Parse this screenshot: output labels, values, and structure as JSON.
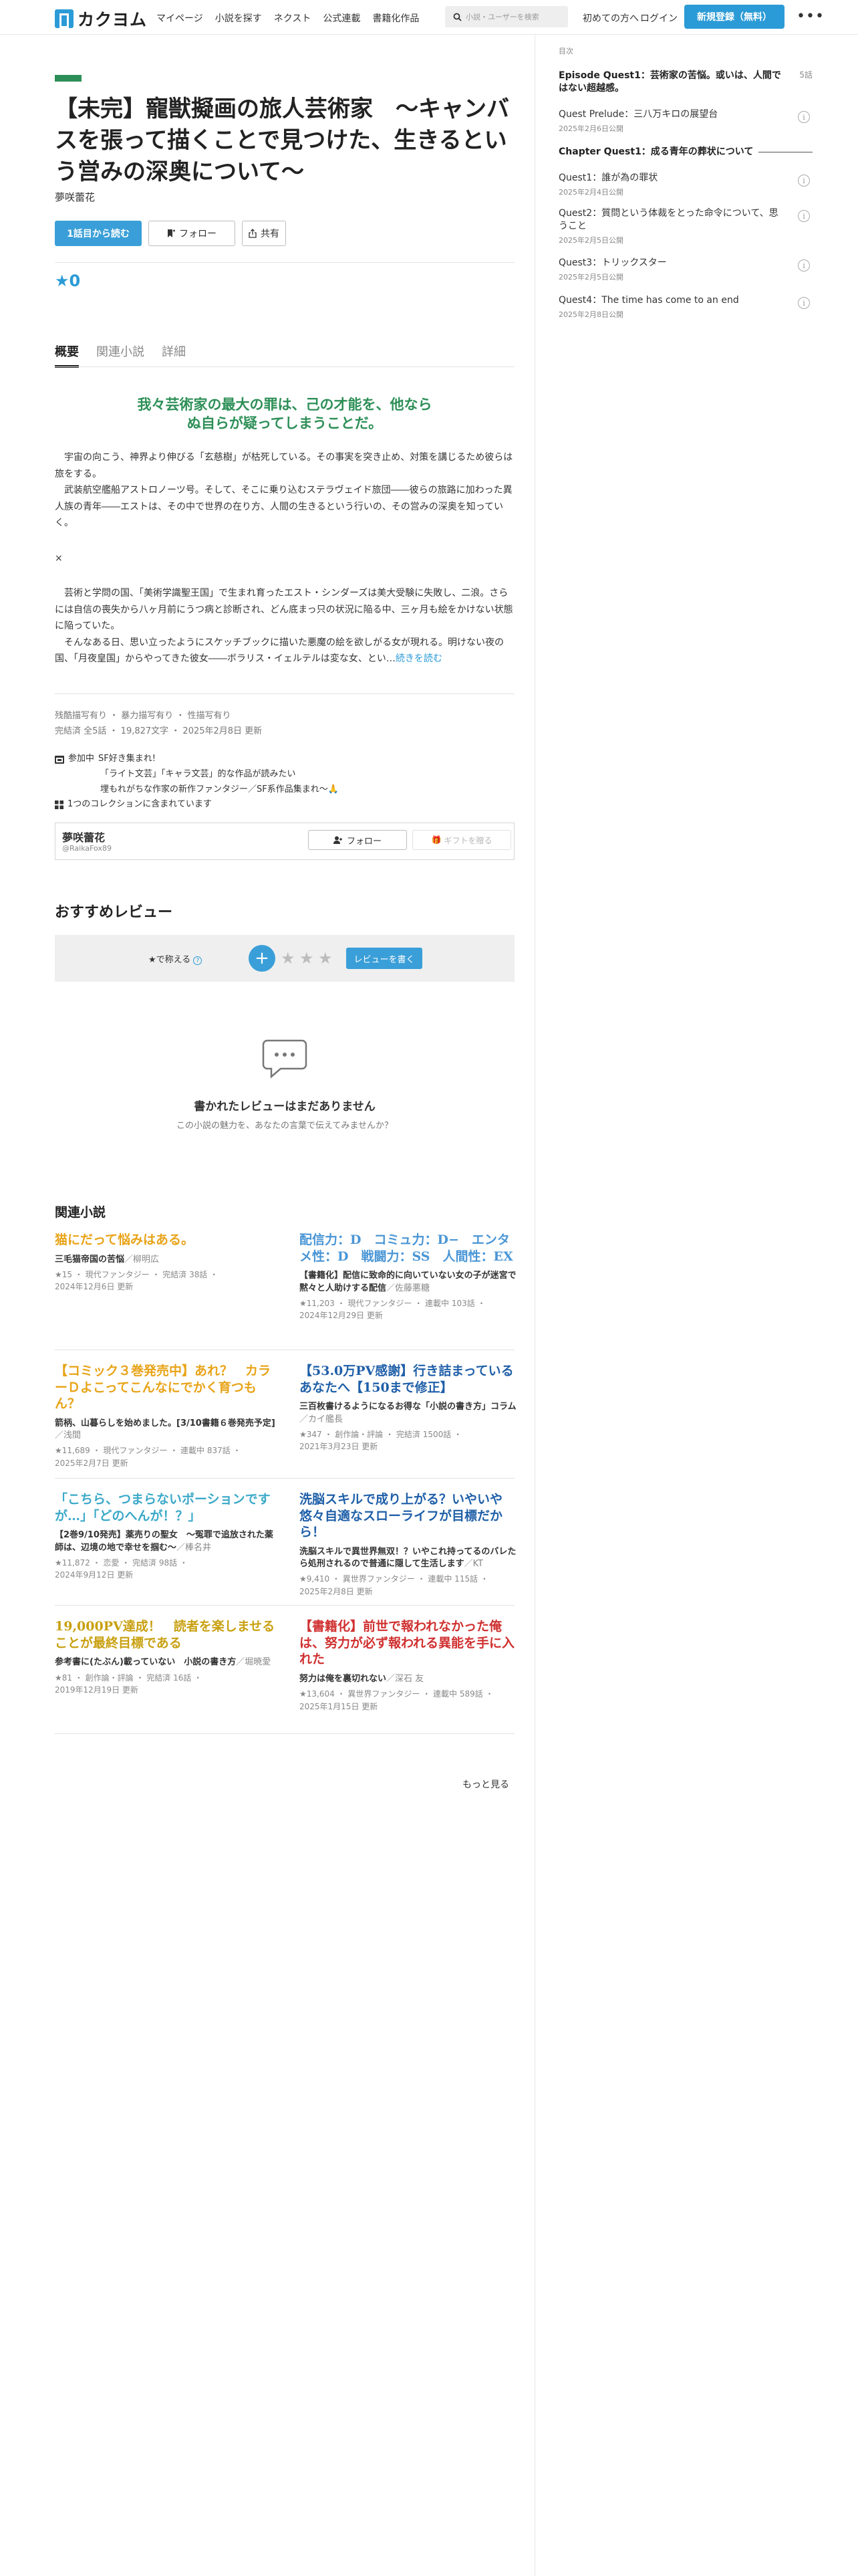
{
  "header": {
    "logo_text": "カクヨム",
    "nav": [
      "マイページ",
      "小説を探す",
      "ネクスト",
      "公式連載",
      "書籍化作品"
    ],
    "search_placeholder": "小説・ユーザーを検索",
    "first_time": "初めての方へ",
    "login": "ログイン",
    "signup": "新規登録（無料）",
    "more": "•••"
  },
  "work": {
    "title": "【未完】寵獣擬画の旅人芸術家　〜キャンバスを張って描くことで見つけた、生きるという営みの深奥について〜",
    "author": "夢咲蕾花",
    "read_first": "1話目から読む",
    "follow": "フォロー",
    "share": "共有",
    "stars": "★0"
  },
  "tabs": [
    "概要",
    "関連小説",
    "詳細"
  ],
  "catchphrase": "我々芸術家の最大の罪は、己の才能を、他ならぬ自らが疑ってしまうことだ。",
  "intro": {
    "p1": "宇宙の向こう、神界より伸びる「玄慈樹」が枯死している。その事実を突き止め、対策を講じるため彼らは旅をする。",
    "p2": "武装航空艦船アストロノーツ号。そして、そこに乗り込むステラヴェイド旅団――彼らの旅路に加わった異人族の青年――エストは、その中で世界の在り方、人間の生きるという行いの、その営みの深奥を知っていく。",
    "sep": "×",
    "p3": "芸術と学問の国、「美術学識聖王国」で生まれ育ったエスト・シンダーズは美大受験に失敗し、二浪。さらには自信の喪失から八ヶ月前にうつ病と診断され、どん底まっ只の状況に陥る中、三ヶ月も絵をかけない状態に陥っていた。",
    "p4": "そんなある日、思い立ったようにスケッチブックに描いた悪魔の絵を欲しがる女が現れる。明けない夜の国、「月夜皇国」からやってきた彼女――ボラリス・イェルテルは変な女、とい…",
    "more": "続きを読む"
  },
  "meta": {
    "warnings": "残酷描写有り ・ 暴力描写有り ・ 性描写有り",
    "stats": "完結済 全5話 ・ 19,827文字 ・ 2025年2月8日 更新"
  },
  "tags": {
    "event_label": "参加中",
    "event_name": "SF好き集まれ!",
    "line2": "「ライト文芸」「キャラ文芸」的な作品が読みたい",
    "line3": "埋もれがちな作家の新作ファンタジー／SF系作品集まれ〜🙏",
    "collection": "1つのコレクションに含まれています"
  },
  "author_card": {
    "name": "夢咲蕾花",
    "handle": "@RaikaFox89",
    "follow": "フォロー",
    "gift": "ギフトを贈る"
  },
  "reviews": {
    "title": "おすすめレビュー",
    "teach": "★で称える",
    "help": "?",
    "plus": "+",
    "stars": [
      "★",
      "★",
      "★"
    ],
    "write": "レビューを書く",
    "empty_title": "書かれたレビューはまだありません",
    "empty_sub": "この小説の魅力を、あなたの言葉で伝えてみませんか？"
  },
  "related": {
    "title": "関連小説",
    "items": [
      {
        "title": "猫にだって悩みはある。",
        "color": "#e8a317",
        "sub": "三毛猫帝国の苦悩",
        "by": "／柳明広",
        "meta1": "★15 ・ 現代ファンタジー ・ 完結済 38話 ・",
        "meta2": "2024年12月6日 更新"
      },
      {
        "title": "配信力：D　コミュ力：D−　エンタメ性：D　戦闘力：SS　人間性：EX",
        "color": "#4a96d6",
        "sub": "【書籍化】配信に致命的に向いていない女の子が迷宮で黙々と人助けする配信",
        "by": "／佐藤悪糖",
        "meta1": "★11,203 ・ 現代ファンタジー ・ 連載中 103話 ・",
        "meta2": "2024年12月29日 更新"
      },
      {
        "title": "【コミック３巻発売中】あれ？　カラーＤよこってこんなにでかく育つもん？",
        "color": "#e8a317",
        "sub": "箭柄、山暮らしを始めました。[3/10書籍６巻発売予定]",
        "by": "／浅間",
        "meta1": "★11,689 ・ 現代ファンタジー ・ 連載中 837話 ・",
        "meta2": "2025年2月7日 更新"
      },
      {
        "title": "【53.0万PV感謝】行き詰まっているあなたへ【150まで修正】",
        "color": "#1f5fa8",
        "sub": "三百枚書けるようになるお得な「小説の書き方」コラム",
        "by": "／カイ艦長",
        "meta1": "★347 ・ 創作論・評論 ・ 完結済 1500話 ・",
        "meta2": "2021年3月23日 更新"
      },
      {
        "title": "「こちら、つまらないポーションですが…」「どのへんが！？」",
        "color": "#3aa8c8",
        "sub": "【2巻9/10発売】薬売りの聖女　〜冤罪で追放された薬師は、辺境の地で幸せを掴む〜",
        "by": "／棒名井",
        "meta1": "★11,872 ・ 恋愛 ・ 完結済 98話 ・",
        "meta2": "2024年9月12日 更新"
      },
      {
        "title": "洗脳スキルで成り上がる？いやいや悠々自適なスローライフが目標だから！",
        "color": "#1f5fa8",
        "sub": "洗脳スキルで異世界無双！？いやこれ持ってるのバレたら処刑されるので普通に隠して生活します",
        "by": "／KT",
        "meta1": "★9,410 ・ 異世界ファンタジー ・ 連載中 115話 ・",
        "meta2": "2025年2月8日 更新"
      },
      {
        "title": "19,000PV達成！　読者を楽しませることが最終目標である",
        "color": "#c8a010",
        "sub": "参考書に(たぶん)載っていない　小説の書き方",
        "by": "／堀暁愛",
        "meta1": "★81 ・ 創作論・評論 ・ 完結済 16話 ・",
        "meta2": "2019年12月19日 更新"
      },
      {
        "title": "【書籍化】前世で報われなかった俺は、努力が必ず報われる異能を手に入れた",
        "color": "#d03030",
        "sub": "努力は俺を裏切れない",
        "by": "／深石 友",
        "meta1": "★13,604 ・ 異世界ファンタジー ・ 連載中 589話 ・",
        "meta2": "2025年1月15日 更新"
      }
    ],
    "more": "もっと見る"
  },
  "toc": {
    "head": "目次",
    "ep1_title": "Episode Quest1：芸術家の苦悩。或いは、人間ではない超越感。",
    "ep1_count": "5話",
    "ep_items": [
      {
        "title": "Quest Prelude：三八万キロの展望台",
        "date": "2025年2月6日公開"
      }
    ],
    "chap_title": "Chapter Quest1：成る青年の葬状について",
    "items": [
      {
        "title": "Quest1：誰が為の罪状",
        "date": "2025年2月4日公開"
      },
      {
        "title": "Quest2：質問という体裁をとった命令について、思うこと",
        "date": "2025年2月5日公開"
      },
      {
        "title": "Quest3：トリックスター",
        "date": "2025年2月5日公開"
      },
      {
        "title": "Quest4：The time has come to an end",
        "date": "2025年2月8日公開"
      }
    ],
    "info_icon": "i"
  }
}
